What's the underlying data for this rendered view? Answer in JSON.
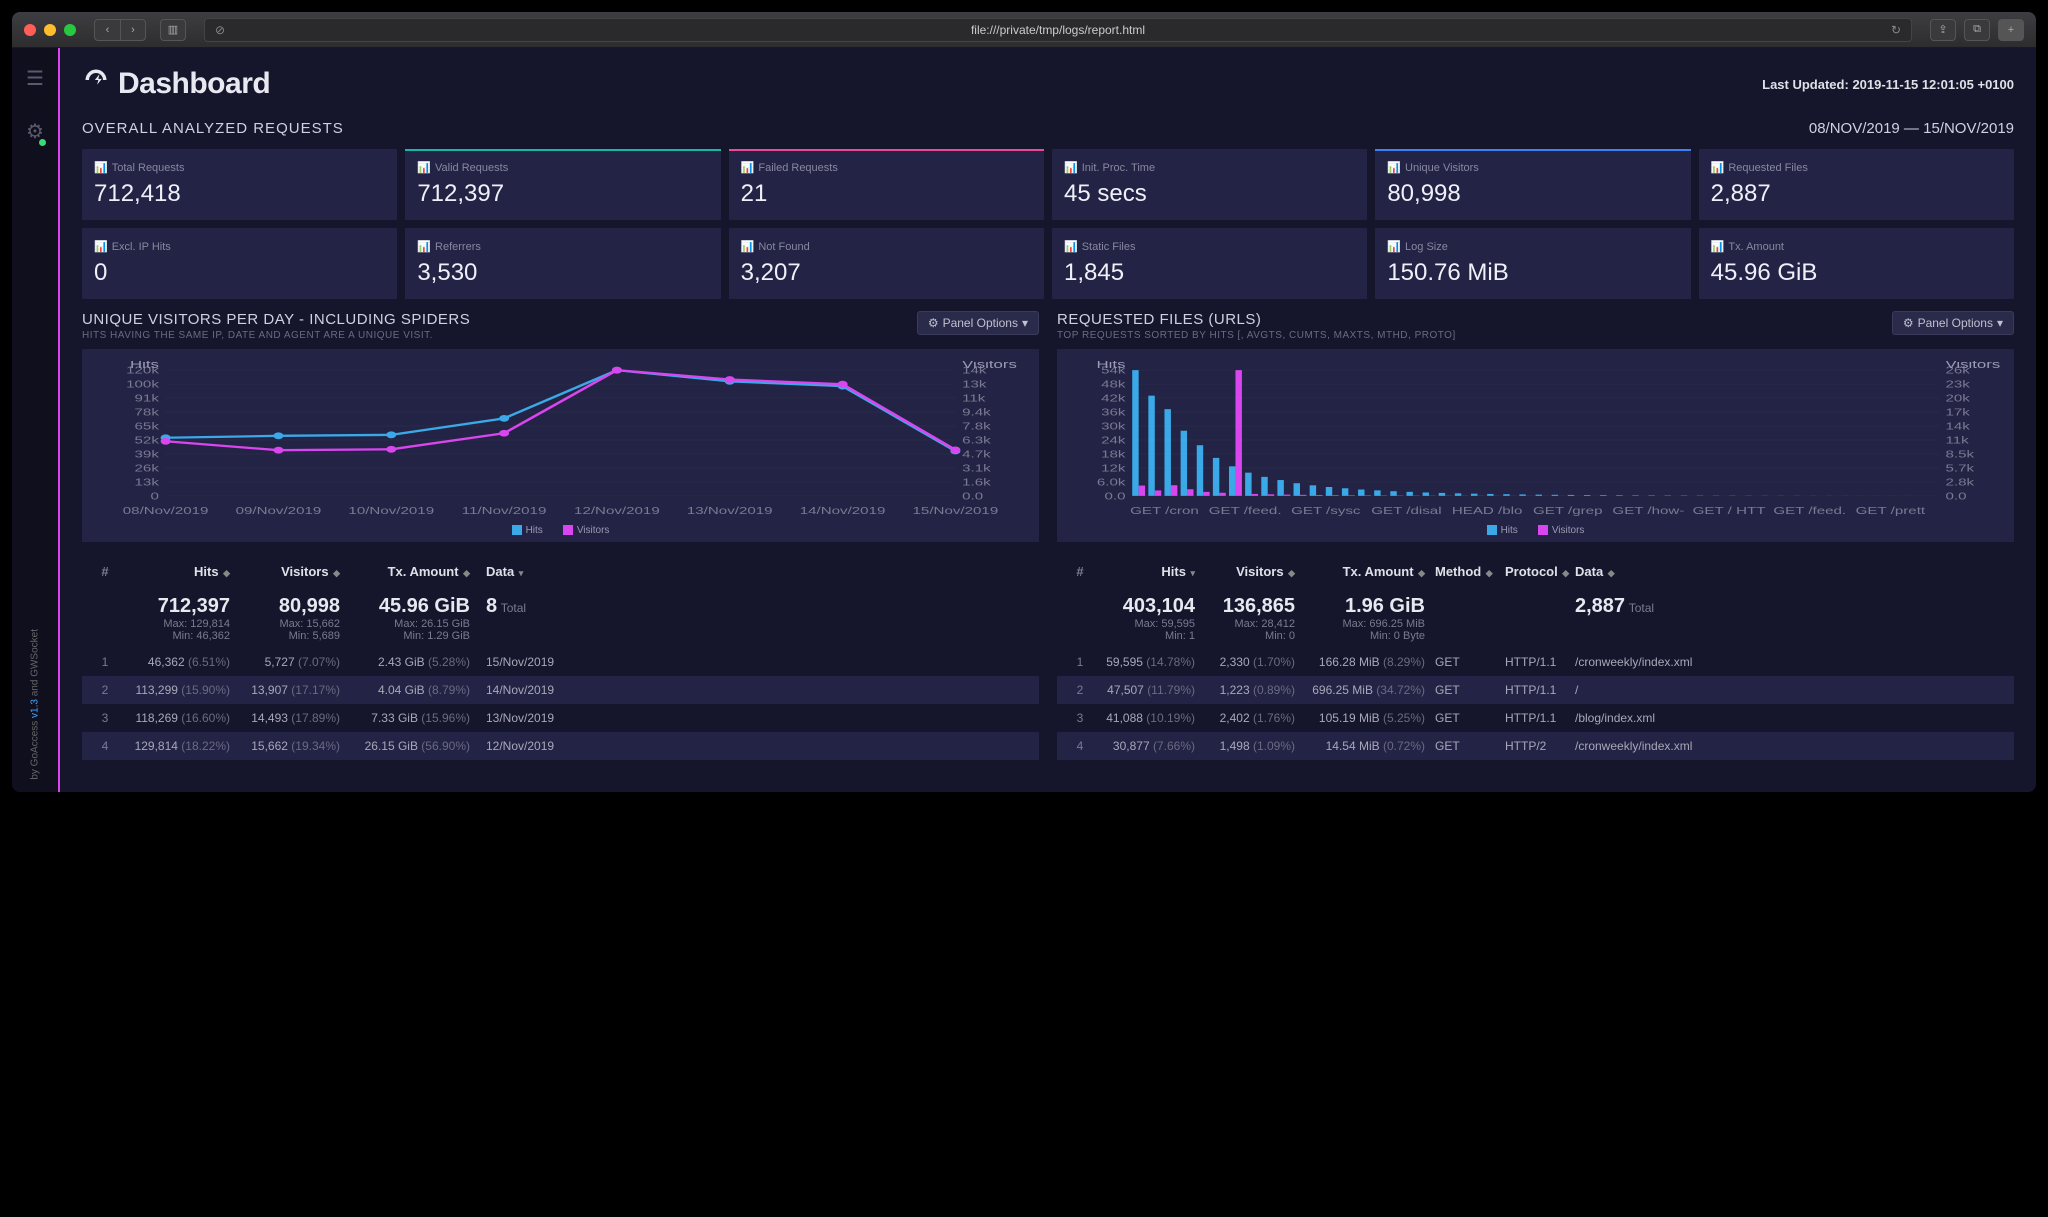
{
  "browser": {
    "url": "file:///private/tmp/logs/report.html"
  },
  "header": {
    "title": "Dashboard",
    "last_updated_label": "Last Updated:",
    "last_updated_value": "2019-11-15 12:01:05 +0100"
  },
  "overview": {
    "title": "OVERALL ANALYZED REQUESTS",
    "date_range": "08/NOV/2019 — 15/NOV/2019",
    "metrics": [
      {
        "label": "Total Requests",
        "value": "712,418",
        "accent": ""
      },
      {
        "label": "Valid Requests",
        "value": "712,397",
        "accent": "teal"
      },
      {
        "label": "Failed Requests",
        "value": "21",
        "accent": "pink"
      },
      {
        "label": "Init. Proc. Time",
        "value": "45 secs",
        "accent": ""
      },
      {
        "label": "Unique Visitors",
        "value": "80,998",
        "accent": "blue"
      },
      {
        "label": "Requested Files",
        "value": "2,887",
        "accent": ""
      },
      {
        "label": "Excl. IP Hits",
        "value": "0",
        "accent": ""
      },
      {
        "label": "Referrers",
        "value": "3,530",
        "accent": ""
      },
      {
        "label": "Not Found",
        "value": "3,207",
        "accent": ""
      },
      {
        "label": "Static Files",
        "value": "1,845",
        "accent": ""
      },
      {
        "label": "Log Size",
        "value": "150.76 MiB",
        "accent": ""
      },
      {
        "label": "Tx. Amount",
        "value": "45.96 GiB",
        "accent": ""
      }
    ]
  },
  "panel_options_label": "Panel Options",
  "visitors_panel": {
    "title": "UNIQUE VISITORS PER DAY - INCLUDING SPIDERS",
    "subtitle": "HITS HAVING THE SAME IP, DATE AND AGENT ARE A UNIQUE VISIT.",
    "headers": [
      "#",
      "Hits",
      "Visitors",
      "Tx. Amount",
      "Data"
    ],
    "summary": {
      "hits": "712,397",
      "hits_max": "Max: 129,814",
      "hits_min": "Min: 46,362",
      "visitors": "80,998",
      "visitors_max": "Max: 15,662",
      "visitors_min": "Min: 5,689",
      "tx": "45.96 GiB",
      "tx_max": "Max: 26.15 GiB",
      "tx_min": "Min: 1.29 GiB",
      "total_n": "8",
      "total_label": "Total"
    },
    "rows": [
      {
        "idx": "1",
        "hits": "46,362",
        "hits_pct": "(6.51%)",
        "vis": "5,727",
        "vis_pct": "(7.07%)",
        "tx": "2.43 GiB",
        "tx_pct": "(5.28%)",
        "data": "15/Nov/2019"
      },
      {
        "idx": "2",
        "hits": "113,299",
        "hits_pct": "(15.90%)",
        "vis": "13,907",
        "vis_pct": "(17.17%)",
        "tx": "4.04 GiB",
        "tx_pct": "(8.79%)",
        "data": "14/Nov/2019"
      },
      {
        "idx": "3",
        "hits": "118,269",
        "hits_pct": "(16.60%)",
        "vis": "14,493",
        "vis_pct": "(17.89%)",
        "tx": "7.33 GiB",
        "tx_pct": "(15.96%)",
        "data": "13/Nov/2019"
      },
      {
        "idx": "4",
        "hits": "129,814",
        "hits_pct": "(18.22%)",
        "vis": "15,662",
        "vis_pct": "(19.34%)",
        "tx": "26.15 GiB",
        "tx_pct": "(56.90%)",
        "data": "12/Nov/2019"
      }
    ]
  },
  "requests_panel": {
    "title": "REQUESTED FILES (URLS)",
    "subtitle": "TOP REQUESTS SORTED BY HITS [, AVGTS, CUMTS, MAXTS, MTHD, PROTO]",
    "headers": [
      "#",
      "Hits",
      "Visitors",
      "Tx. Amount",
      "Method",
      "Protocol",
      "Data"
    ],
    "summary": {
      "hits": "403,104",
      "hits_max": "Max: 59,595",
      "hits_min": "Min: 1",
      "visitors": "136,865",
      "visitors_max": "Max: 28,412",
      "visitors_min": "Min: 0",
      "tx": "1.96 GiB",
      "tx_max": "Max: 696.25 MiB",
      "tx_min": "Min: 0 Byte",
      "total_n": "2,887",
      "total_label": "Total"
    },
    "rows": [
      {
        "idx": "1",
        "hits": "59,595",
        "hits_pct": "(14.78%)",
        "vis": "2,330",
        "vis_pct": "(1.70%)",
        "tx": "166.28 MiB",
        "tx_pct": "(8.29%)",
        "method": "GET",
        "proto": "HTTP/1.1",
        "data": "/cronweekly/index.xml"
      },
      {
        "idx": "2",
        "hits": "47,507",
        "hits_pct": "(11.79%)",
        "vis": "1,223",
        "vis_pct": "(0.89%)",
        "tx": "696.25 MiB",
        "tx_pct": "(34.72%)",
        "method": "GET",
        "proto": "HTTP/1.1",
        "data": "/"
      },
      {
        "idx": "3",
        "hits": "41,088",
        "hits_pct": "(10.19%)",
        "vis": "2,402",
        "vis_pct": "(1.76%)",
        "tx": "105.19 MiB",
        "tx_pct": "(5.25%)",
        "method": "GET",
        "proto": "HTTP/1.1",
        "data": "/blog/index.xml"
      },
      {
        "idx": "4",
        "hits": "30,877",
        "hits_pct": "(7.66%)",
        "vis": "1,498",
        "vis_pct": "(1.09%)",
        "tx": "14.54 MiB",
        "tx_pct": "(0.72%)",
        "method": "GET",
        "proto": "HTTP/2",
        "data": "/cronweekly/index.xml"
      }
    ]
  },
  "chart_data": [
    {
      "type": "line",
      "title": "Unique Visitors Per Day",
      "categories": [
        "08/Nov/2019",
        "09/Nov/2019",
        "10/Nov/2019",
        "11/Nov/2019",
        "12/Nov/2019",
        "13/Nov/2019",
        "14/Nov/2019",
        "15/Nov/2019"
      ],
      "series": [
        {
          "name": "Hits",
          "values": [
            60000,
            62000,
            63000,
            80000,
            129814,
            118269,
            113299,
            46362
          ]
        },
        {
          "name": "Visitors",
          "values": [
            6800,
            5689,
            5800,
            7800,
            15662,
            14493,
            13907,
            5727
          ]
        }
      ],
      "ylabel_left": "Hits",
      "ylabel_right": "Visitors",
      "yticks_left": [
        "0",
        "13k",
        "26k",
        "39k",
        "52k",
        "65k",
        "78k",
        "91k",
        "100k",
        "120k"
      ],
      "yticks_right": [
        "0.0",
        "1.6k",
        "3.1k",
        "4.7k",
        "6.3k",
        "7.8k",
        "9.4k",
        "11k",
        "13k",
        "14k"
      ],
      "legend": [
        "Hits",
        "Visitors"
      ]
    },
    {
      "type": "bar",
      "title": "Requested Files",
      "categories": [
        "GET /cron",
        "GET /feed.",
        "GET /sysc",
        "GET /disal",
        "HEAD /blo",
        "GET /grep",
        "GET /how-",
        "GET / HTT",
        "GET /feed.",
        "GET /prett"
      ],
      "series": [
        {
          "name": "Hits",
          "values": [
            59595,
            47507,
            41088,
            30877,
            24000,
            18000,
            14000,
            11000,
            9000,
            7500,
            6000,
            5000,
            4200,
            3600,
            3000,
            2600,
            2200,
            1900,
            1600,
            1400,
            1200,
            1050,
            900,
            780,
            680,
            590,
            510,
            440,
            380,
            330,
            285,
            245,
            210,
            180,
            155,
            130,
            110,
            95,
            80,
            68,
            58,
            49,
            42,
            36,
            30,
            25,
            21,
            18,
            15,
            12
          ]
        },
        {
          "name": "Visitors",
          "values": [
            2330,
            1223,
            2402,
            1498,
            900,
            700,
            28412,
            430,
            350,
            280,
            230,
            190,
            155,
            128,
            105,
            86,
            71,
            58,
            48,
            39,
            32,
            26,
            22,
            18,
            15,
            12,
            10,
            8,
            7,
            6,
            5,
            4,
            3,
            3,
            2,
            2,
            2,
            1,
            1,
            1,
            1,
            1,
            1,
            1,
            1,
            1,
            1,
            1,
            1,
            0
          ]
        }
      ],
      "ylabel_left": "Hits",
      "ylabel_right": "Visitors",
      "yticks_left": [
        "0.0",
        "6.0k",
        "12k",
        "18k",
        "24k",
        "30k",
        "36k",
        "42k",
        "48k",
        "54k"
      ],
      "yticks_right": [
        "0.0",
        "2.8k",
        "5.7k",
        "8.5k",
        "11k",
        "14k",
        "17k",
        "20k",
        "23k",
        "26k"
      ],
      "legend": [
        "Hits",
        "Visitors"
      ]
    }
  ],
  "footer": {
    "by": "by GoAccess",
    "version": "v1.3",
    "and": "and GWSocket"
  }
}
